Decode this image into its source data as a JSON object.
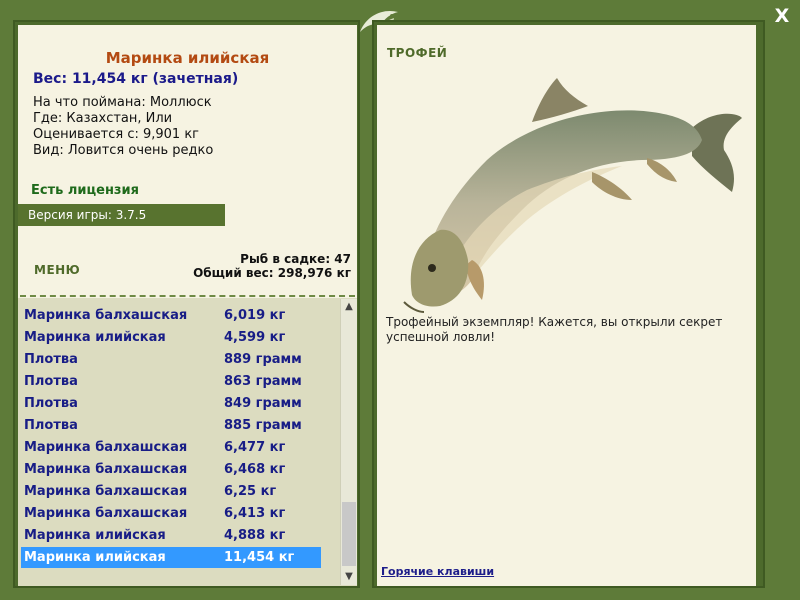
{
  "window": {
    "close_label": "X"
  },
  "fish_info": {
    "title": "Маринка илийская",
    "weight_line": "Вес: 11,454 кг (зачетная)",
    "caught_on": "На что поймана: Моллюск",
    "location": "Где: Казахстан, Или",
    "valued_from": "Оценивается с: 9,901 кг",
    "rarity": "Вид: Ловится очень редко"
  },
  "license_label": "Есть лицензия",
  "version_label": "Версия игры: 3.7.5",
  "menu_label": "МЕНЮ",
  "keepnet": {
    "count_line": "Рыб в садке: 47",
    "total_line": "Общий вес: 298,976 кг"
  },
  "catch_list": [
    {
      "name": "Маринка балхашская",
      "weight": "6,019 кг"
    },
    {
      "name": "Маринка илийская",
      "weight": "4,599 кг"
    },
    {
      "name": "Плотва",
      "weight": "889 грамм"
    },
    {
      "name": "Плотва",
      "weight": "863 грамм"
    },
    {
      "name": "Плотва",
      "weight": "849 грамм"
    },
    {
      "name": "Плотва",
      "weight": "885 грамм"
    },
    {
      "name": "Маринка балхашская",
      "weight": "6,477 кг"
    },
    {
      "name": "Маринка балхашская",
      "weight": "6,468 кг"
    },
    {
      "name": "Маринка балхашская",
      "weight": "6,25 кг"
    },
    {
      "name": "Маринка балхашская",
      "weight": "6,413 кг"
    },
    {
      "name": "Маринка илийская",
      "weight": "4,888 кг"
    },
    {
      "name": "Маринка илийская",
      "weight": "11,454 кг"
    }
  ],
  "selected_index": 11,
  "scroll_icons": {
    "up": "chevron-up-icon",
    "down": "chevron-down-icon"
  },
  "trophy": {
    "title": "ТРОФЕЙ",
    "text": "Трофейный экземпляр! Кажется, вы открыли секрет успешной ловли!"
  },
  "hotkeys_label": "Горячие клавиши",
  "colors": {
    "frame_green": "#5e7b39",
    "panel_bg": "#f6f3e2",
    "list_bg": "#dcdcc0",
    "selection": "#3399ff",
    "title_orange": "#b34a12",
    "text_navy": "#181d86"
  }
}
